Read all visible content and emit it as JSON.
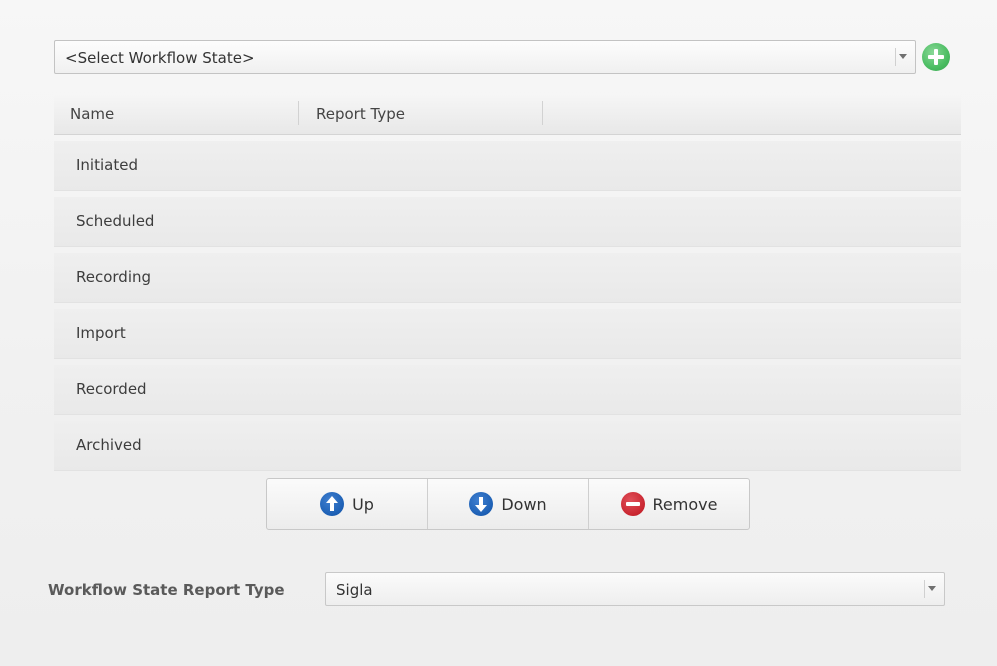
{
  "state_select": {
    "value": "<Select Workflow State>",
    "add_icon": "plus-circle-icon",
    "accent_color": "#4bbd62"
  },
  "table": {
    "columns": [
      "Name",
      "Report Type"
    ],
    "rows": [
      {
        "name": "Initiated",
        "report_type": ""
      },
      {
        "name": "Scheduled",
        "report_type": ""
      },
      {
        "name": "Recording",
        "report_type": ""
      },
      {
        "name": "Import",
        "report_type": ""
      },
      {
        "name": "Recorded",
        "report_type": ""
      },
      {
        "name": "Archived",
        "report_type": ""
      }
    ]
  },
  "actions": {
    "up_label": "Up",
    "down_label": "Down",
    "remove_label": "Remove",
    "up_icon": "arrow-up-circle-icon",
    "down_icon": "arrow-down-circle-icon",
    "remove_icon": "minus-circle-icon"
  },
  "report_type": {
    "label": "Workflow State Report Type",
    "value": "Sigla"
  }
}
